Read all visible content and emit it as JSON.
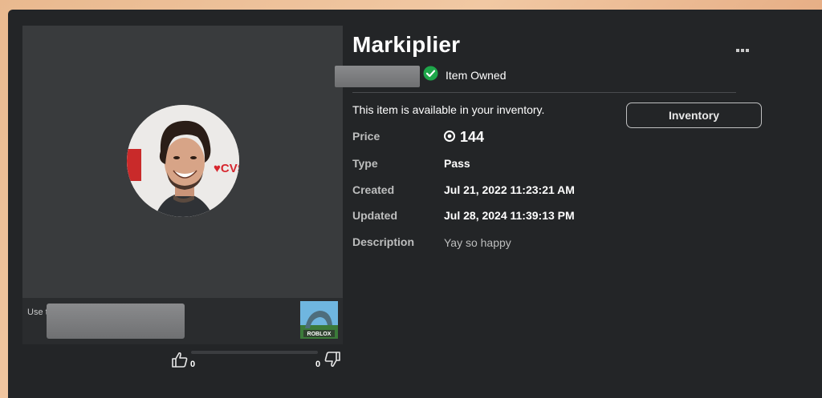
{
  "item": {
    "title": "Markiplier",
    "owned_label": "Item Owned",
    "availability_text": "This item is available in your inventory.",
    "inventory_button": "Inventory"
  },
  "details": {
    "price_label": "Price",
    "price_value": "144",
    "type_label": "Type",
    "type_value": "Pass",
    "created_label": "Created",
    "created_value": "Jul 21, 2022 11:23:21 AM",
    "updated_label": "Updated",
    "updated_value": "Jul 28, 2024 11:39:13 PM",
    "description_label": "Description",
    "description_value": "Yay so happy"
  },
  "footer": {
    "use_text": "Use t",
    "game_badge": "ROBLOX"
  },
  "votes": {
    "up_count": "0",
    "down_count": "0"
  },
  "colors": {
    "owned_check": "#1ea64a",
    "panel_bg": "#232527"
  }
}
